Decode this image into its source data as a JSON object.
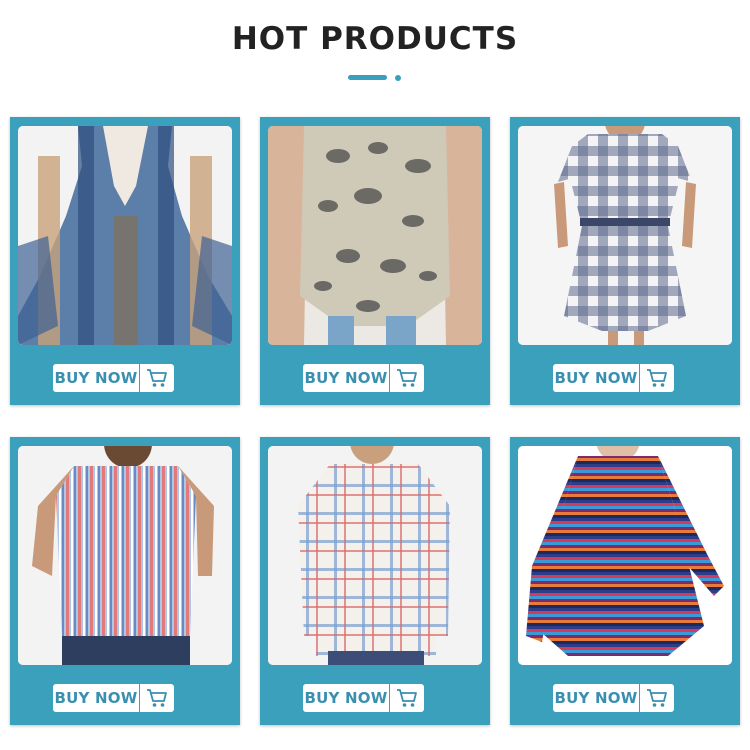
{
  "header": {
    "title": "HOT PRODUCTS"
  },
  "colors": {
    "accent": "#3aa0bc",
    "button_text": "#3a8fb0",
    "title": "#222222"
  },
  "products": [
    {
      "image": "blue paisley print kimono cardigan",
      "button_label": "BUY NOW",
      "icon": "shopping-cart-icon"
    },
    {
      "image": "snakeskin print sleeveless top",
      "button_label": "BUY NOW",
      "icon": "shopping-cart-icon"
    },
    {
      "image": "navy gingham belted shirt dress",
      "button_label": "BUY NOW",
      "icon": "shopping-cart-icon"
    },
    {
      "image": "multicolor striped tie-front shirt",
      "button_label": "BUY NOW",
      "icon": "shopping-cart-icon"
    },
    {
      "image": "white plaid long sleeve tunic",
      "button_label": "BUY NOW",
      "icon": "shopping-cart-icon"
    },
    {
      "image": "rainbow striped pleated tunic dress",
      "button_label": "BUY NOW",
      "icon": "shopping-cart-icon"
    }
  ]
}
